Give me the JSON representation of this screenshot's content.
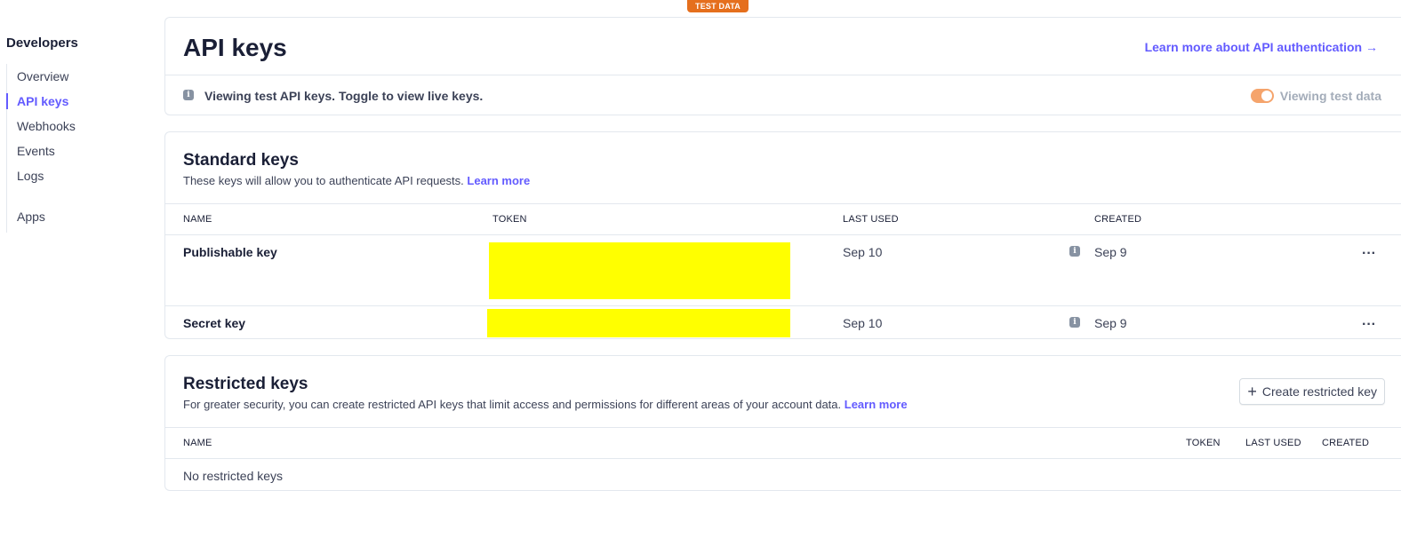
{
  "badge": "TEST DATA",
  "sidebar": {
    "title": "Developers",
    "items": [
      {
        "label": "Overview"
      },
      {
        "label": "API keys"
      },
      {
        "label": "Webhooks"
      },
      {
        "label": "Events"
      },
      {
        "label": "Logs"
      },
      {
        "label": "Apps"
      }
    ],
    "active_index": 1
  },
  "header": {
    "title": "API keys",
    "learn_link": "Learn more about API authentication",
    "learn_arrow": "→",
    "info_text": "Viewing test API keys. Toggle to view live keys.",
    "toggle_label": "Viewing test data",
    "toggle_on": true
  },
  "standard": {
    "title": "Standard keys",
    "description": "These keys will allow you to authenticate API requests.",
    "learn_more": "Learn more",
    "columns": [
      "NAME",
      "TOKEN",
      "LAST USED",
      "CREATED"
    ],
    "rows": [
      {
        "name": "Publishable key",
        "last_used": "Sep 10",
        "created": "Sep 9",
        "more": "···"
      },
      {
        "name": "Secret key",
        "last_used": "Sep 10",
        "created": "Sep 9",
        "more": "···"
      }
    ]
  },
  "restricted": {
    "title": "Restricted keys",
    "description": "For greater security, you can create restricted API keys that limit access and permissions for different areas of your account data.",
    "learn_more": "Learn more",
    "create_button": "Create restricted key",
    "columns": [
      "NAME",
      "TOKEN",
      "LAST USED",
      "CREATED"
    ],
    "empty_text": "No restricted keys"
  },
  "colors": {
    "accent": "#635bff",
    "badge": "#e56f1d",
    "toggle": "#f5a46c",
    "redaction": "#ffff00"
  }
}
